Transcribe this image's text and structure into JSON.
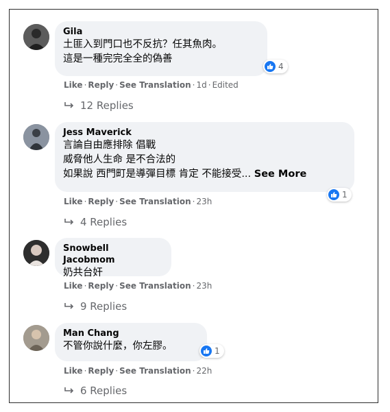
{
  "comments": [
    {
      "author": "Gila",
      "lines": [
        "土匪入到門口也不反抗？任其魚肉。",
        "這是一種完完全全的偽善"
      ],
      "see_more": "",
      "reaction_count": "4",
      "actions": {
        "like": "Like",
        "reply": "Reply",
        "translate": "See Translation",
        "time": "1d",
        "edited": "Edited"
      },
      "replies": "12 Replies",
      "avatar_color": "#4a4a4a"
    },
    {
      "author": "Jess Maverick",
      "lines": [
        "言論自由應排除 倡戰",
        "威脅他人生命 是不合法的",
        "如果說 西門町是導彈目標 肯定 不能接受..."
      ],
      "see_more": "See More",
      "reaction_count": "1",
      "actions": {
        "like": "Like",
        "reply": "Reply",
        "translate": "See Translation",
        "time": "23h",
        "edited": ""
      },
      "replies": "4 Replies",
      "avatar_color": "#6b7280"
    },
    {
      "author": "Snowbell Jacobmom",
      "lines": [
        "奶共台奸"
      ],
      "see_more": "",
      "reaction_count": "",
      "actions": {
        "like": "Like",
        "reply": "Reply",
        "translate": "See Translation",
        "time": "23h",
        "edited": ""
      },
      "replies": "9 Replies",
      "avatar_color": "#3b3b3b"
    },
    {
      "author": "Man Chang",
      "lines": [
        "不管你說什麼，你左膠。"
      ],
      "see_more": "",
      "reaction_count": "1",
      "actions": {
        "like": "Like",
        "reply": "Reply",
        "translate": "See Translation",
        "time": "22h",
        "edited": ""
      },
      "replies": "6 Replies",
      "avatar_color": "#8a8072"
    }
  ],
  "colors": {
    "bubble": "#f0f2f5",
    "like_blue": "#1877f2",
    "meta_gray": "#65676b"
  }
}
